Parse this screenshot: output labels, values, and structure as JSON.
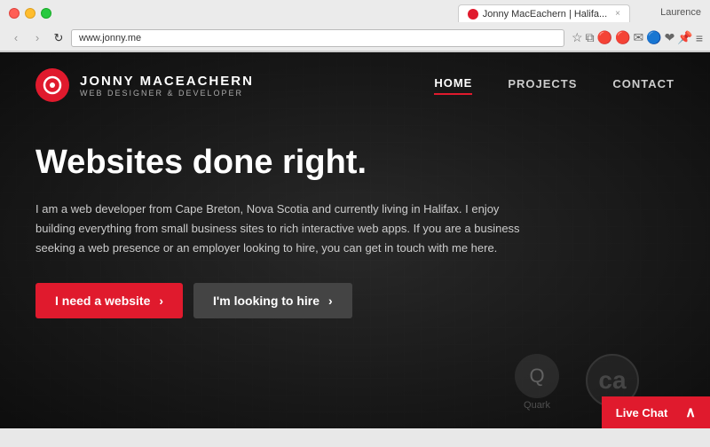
{
  "browser": {
    "tab_title": "Jonny MacEachern | Halifa...",
    "address": "www.jonny.me",
    "user_name": "Laurence",
    "back_btn": "‹",
    "forward_btn": "›",
    "refresh_btn": "↻"
  },
  "site": {
    "logo": {
      "icon": "J",
      "name": "JONNY MACEACHERN",
      "subtitle": "WEB DESIGNER & DEVELOPER"
    },
    "nav": {
      "items": [
        {
          "label": "HOME",
          "active": true
        },
        {
          "label": "PROJECTS",
          "active": false
        },
        {
          "label": "CONTACT",
          "active": false
        }
      ]
    },
    "hero": {
      "title": "Websites done right.",
      "description": "I am a web developer from Cape Breton, Nova Scotia and currently living in Halifax. I enjoy building everything from small business sites to rich interactive web apps. If you are a business seeking a web presence or an employer looking to hire, you can get in touch with me here.",
      "btn_primary": "I need a website",
      "btn_secondary": "I'm looking to hire",
      "arrow": "›"
    },
    "live_chat": {
      "label": "Live Chat",
      "chevron": "∧"
    }
  }
}
